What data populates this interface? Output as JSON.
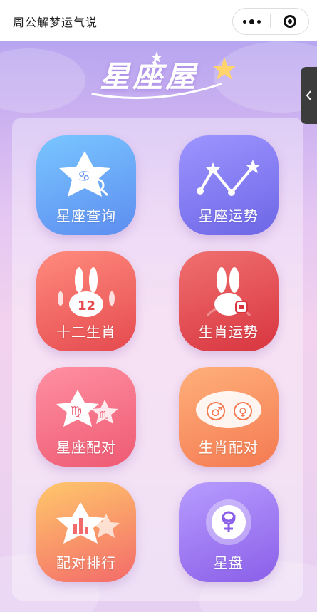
{
  "app": {
    "title": "周公解梦运气说"
  },
  "logo": {
    "text": "星座屋"
  },
  "tiles": [
    {
      "label": "星座查询",
      "icon": "cancer-star-search-icon",
      "color": "#5d8df0"
    },
    {
      "label": "星座运势",
      "icon": "constellation-trend-icon",
      "color": "#6d66e6"
    },
    {
      "label": "十二生肖",
      "icon": "rabbits-12-icon",
      "color": "#e54a4f"
    },
    {
      "label": "生肖运势",
      "icon": "rabbit-fortune-icon",
      "color": "#d8353f"
    },
    {
      "label": "星座配对",
      "icon": "virgo-scorpio-stars-icon",
      "color": "#ee5a72"
    },
    {
      "label": "生肖配对",
      "icon": "male-female-match-icon",
      "color": "#f47a52"
    },
    {
      "label": "配对排行",
      "icon": "ranking-star-icon",
      "color": "#f36a6a"
    },
    {
      "label": "星盘",
      "icon": "astro-chart-icon",
      "color": "#8a5fe8"
    }
  ]
}
